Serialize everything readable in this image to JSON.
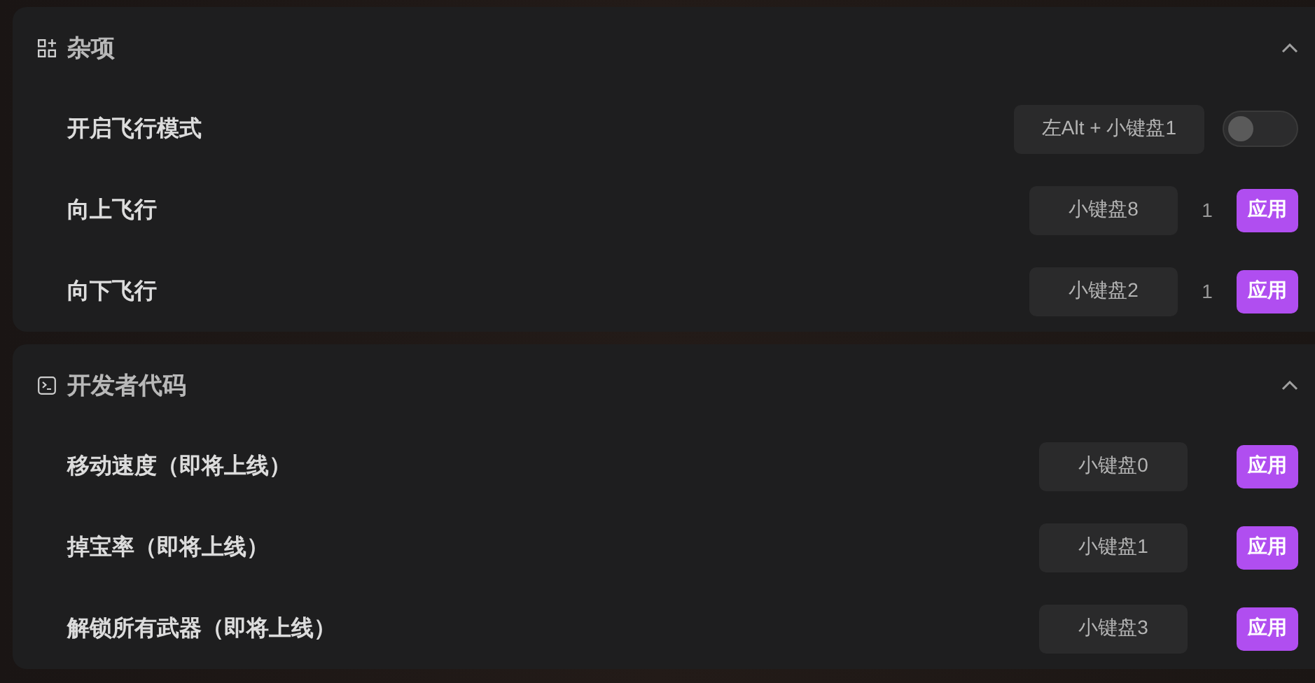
{
  "sections": [
    {
      "title": "杂项",
      "expanded": true,
      "rows": [
        {
          "kind": "toggle",
          "label": "开启飞行模式",
          "key": "左Alt + 小键盘1",
          "on": false
        },
        {
          "kind": "apply",
          "label": "向上飞行",
          "key": "小键盘8",
          "count": "1",
          "button": "应用"
        },
        {
          "kind": "apply",
          "label": "向下飞行",
          "key": "小键盘2",
          "count": "1",
          "button": "应用"
        }
      ]
    },
    {
      "title": "开发者代码",
      "expanded": true,
      "rows": [
        {
          "kind": "apply",
          "label": "移动速度（即将上线）",
          "key": "小键盘0",
          "button": "应用"
        },
        {
          "kind": "apply",
          "label": "掉宝率（即将上线）",
          "key": "小键盘1",
          "button": "应用"
        },
        {
          "kind": "apply",
          "label": "解锁所有武器（即将上线）",
          "key": "小键盘3",
          "button": "应用"
        }
      ]
    }
  ]
}
